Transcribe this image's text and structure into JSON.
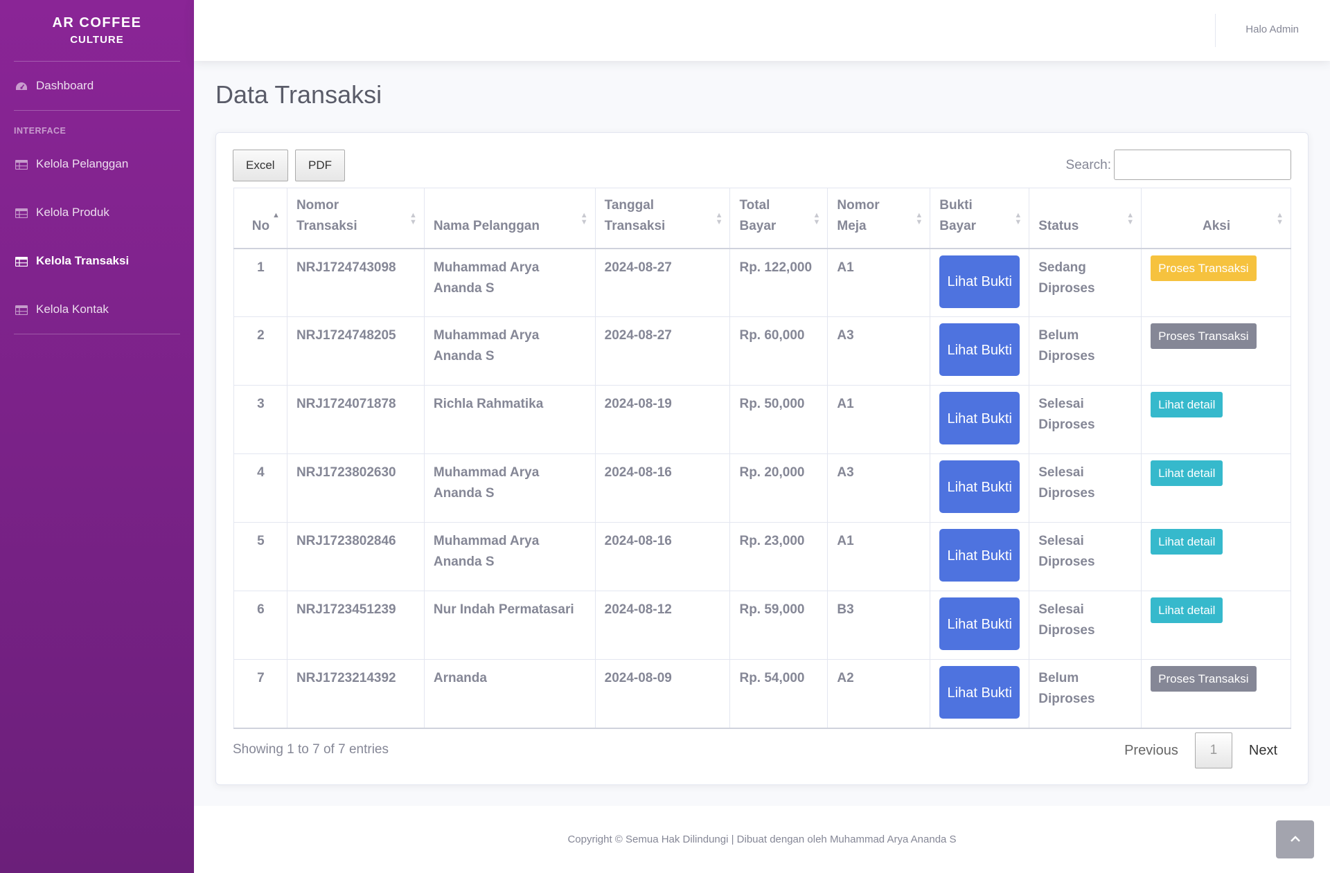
{
  "brand": {
    "line1": "AR COFFEE",
    "line2": "CULTURE"
  },
  "sidebar": {
    "dashboard": "Dashboard",
    "heading": "INTERFACE",
    "items": [
      {
        "label": "Kelola Pelanggan",
        "icon": "table-icon",
        "active": false
      },
      {
        "label": "Kelola Produk",
        "icon": "table-icon",
        "active": false
      },
      {
        "label": "Kelola Transaksi",
        "icon": "table-icon",
        "active": true
      },
      {
        "label": "Kelola Kontak",
        "icon": "table-icon",
        "active": false
      }
    ]
  },
  "topbar": {
    "user": "Halo Admin"
  },
  "page": {
    "title": "Data Transaksi"
  },
  "toolbar": {
    "excel": "Excel",
    "pdf": "PDF",
    "search_label": "Search:",
    "search_value": ""
  },
  "table": {
    "headers": [
      "No",
      "Nomor Transaksi",
      "Nama Pelanggan",
      "Tanggal Transaksi",
      "Total Bayar",
      "Nomor Meja",
      "Bukti Bayar",
      "Status",
      "Aksi"
    ],
    "header_lines": [
      [
        "No"
      ],
      [
        "Nomor",
        "Transaksi"
      ],
      [
        "Nama Pelanggan"
      ],
      [
        "Tanggal",
        "Transaksi"
      ],
      [
        "Total",
        "Bayar"
      ],
      [
        "Nomor",
        "Meja"
      ],
      [
        "Bukti",
        "Bayar"
      ],
      [
        "Status"
      ],
      [
        "Aksi"
      ]
    ],
    "sorted_column": "No",
    "rows": [
      {
        "no": "1",
        "nomor": "NRJ1724743098",
        "nama": "Muhammad Arya Ananda S",
        "tanggal": "2024-08-27",
        "total": "Rp. 122,000",
        "meja": "A1",
        "bukti": "Lihat Bukti",
        "status": "Sedang Diproses",
        "aksi": "Proses Transaksi",
        "aksi_color": "#f6c23e"
      },
      {
        "no": "2",
        "nomor": "NRJ1724748205",
        "nama": "Muhammad Arya Ananda S",
        "tanggal": "2024-08-27",
        "total": "Rp. 60,000",
        "meja": "A3",
        "bukti": "Lihat Bukti",
        "status": "Belum Diproses",
        "aksi": "Proses Transaksi",
        "aksi_color": "#858796"
      },
      {
        "no": "3",
        "nomor": "NRJ1724071878",
        "nama": "Richla Rahmatika",
        "tanggal": "2024-08-19",
        "total": "Rp. 50,000",
        "meja": "A1",
        "bukti": "Lihat Bukti",
        "status": "Selesai Diproses",
        "aksi": "Lihat detail",
        "aksi_color": "#36b9cc"
      },
      {
        "no": "4",
        "nomor": "NRJ1723802630",
        "nama": "Muhammad Arya Ananda S",
        "tanggal": "2024-08-16",
        "total": "Rp. 20,000",
        "meja": "A3",
        "bukti": "Lihat Bukti",
        "status": "Selesai Diproses",
        "aksi": "Lihat detail",
        "aksi_color": "#36b9cc"
      },
      {
        "no": "5",
        "nomor": "NRJ1723802846",
        "nama": "Muhammad Arya Ananda S",
        "tanggal": "2024-08-16",
        "total": "Rp. 23,000",
        "meja": "A1",
        "bukti": "Lihat Bukti",
        "status": "Selesai Diproses",
        "aksi": "Lihat detail",
        "aksi_color": "#36b9cc"
      },
      {
        "no": "6",
        "nomor": "NRJ1723451239",
        "nama": "Nur Indah Permatasari",
        "tanggal": "2024-08-12",
        "total": "Rp. 59,000",
        "meja": "B3",
        "bukti": "Lihat Bukti",
        "status": "Selesai Diproses",
        "aksi": "Lihat detail",
        "aksi_color": "#36b9cc"
      },
      {
        "no": "7",
        "nomor": "NRJ1723214392",
        "nama": "Arnanda",
        "tanggal": "2024-08-09",
        "total": "Rp. 54,000",
        "meja": "A2",
        "bukti": "Lihat Bukti",
        "status": "Belum Diproses",
        "aksi": "Proses Transaksi",
        "aksi_color": "#858796"
      }
    ]
  },
  "pagination": {
    "info": "Showing 1 to 7 of 7 entries",
    "previous": "Previous",
    "current": "1",
    "next": "Next"
  },
  "footer": {
    "text": "Copyright © Semua Hak Dilindungi | Dibuat dengan oleh Muhammad Arya Ananda S"
  },
  "scroll_top": {
    "icon": "chevron-up-icon"
  },
  "colors": {
    "sidebar_top": "#8a2596",
    "sidebar_bottom": "#6b1f7a",
    "primary": "#4e73df",
    "warning": "#f6c23e",
    "secondary": "#858796",
    "info": "#36b9cc"
  }
}
